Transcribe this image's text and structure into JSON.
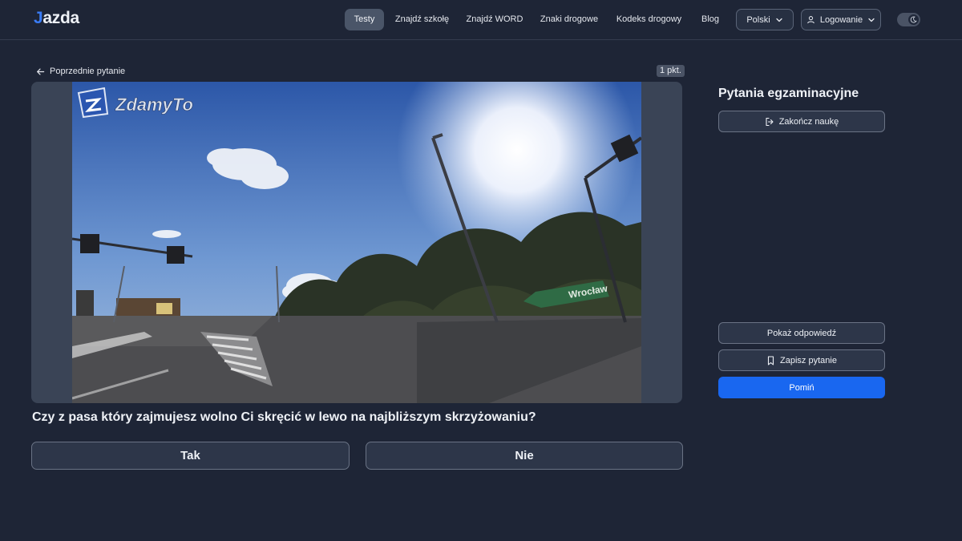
{
  "nav": {
    "logo_first": "J",
    "logo_rest": "azda",
    "items": [
      {
        "label": "Testy",
        "active": true
      },
      {
        "label": "Znajdź szkołę",
        "active": false
      },
      {
        "label": "Znajdź WORD",
        "active": false
      },
      {
        "label": "Znaki drogowe",
        "active": false
      },
      {
        "label": "Kodeks drogowy",
        "active": false
      },
      {
        "label": "Blog",
        "active": false
      }
    ],
    "language": "Polski",
    "login": "Logowanie"
  },
  "question": {
    "back_label": "Poprzednie pytanie",
    "points": "1 pkt.",
    "media": {
      "watermark": "ZdamyTo",
      "sign_text": "Wrocław"
    },
    "text": "Czy z pasa który zajmujesz wolno Ci skręcić w lewo na najbliższym skrzyżowaniu?",
    "answers": [
      "Tak",
      "Nie"
    ]
  },
  "sidebar": {
    "title": "Pytania egzaminacyjne",
    "end_button": "Zakończ naukę",
    "show_answer": "Pokaż odpowiedź",
    "save_question": "Zapisz pytanie",
    "skip": "Pomiń"
  },
  "colors": {
    "background": "#1e2536",
    "accent": "#1967f0",
    "logo_accent": "#3a7cf6"
  }
}
